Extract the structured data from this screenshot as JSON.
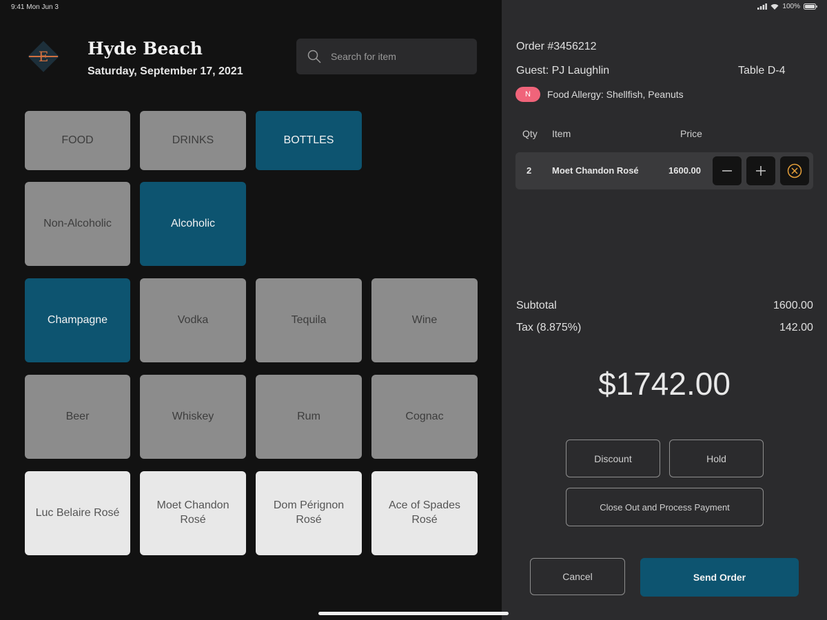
{
  "status_bar": {
    "time_date": "9:41 Mon Jun 3",
    "battery": "100%"
  },
  "header": {
    "venue": "Hyde Beach",
    "date": "Saturday, September 17, 2021",
    "logo_letter": "E"
  },
  "search": {
    "placeholder": "Search for item"
  },
  "categories": [
    "FOOD",
    "DRINKS",
    "BOTTLES"
  ],
  "subcategories": [
    "Non-Alcoholic",
    "Alcoholic"
  ],
  "drink_types": [
    "Champagne",
    "Vodka",
    "Tequila",
    "Wine",
    "Beer",
    "Whiskey",
    "Rum",
    "Cognac"
  ],
  "products": [
    "Luc Belaire Rosé",
    "Moet Chandon Rosé",
    "Dom Pérignon Rosé",
    "Ace of Spades Rosé"
  ],
  "order": {
    "number": "Order #3456212",
    "guest": "Guest: PJ Laughlin",
    "table": "Table D-4",
    "allergy_badge": "N",
    "allergy": "Food Allergy: Shellfish, Peanuts",
    "columns": {
      "qty": "Qty",
      "item": "Item",
      "price": "Price"
    },
    "items": [
      {
        "qty": "2",
        "name": "Moet Chandon Rosé",
        "price": "1600.00"
      }
    ],
    "subtotal_label": "Subtotal",
    "subtotal": "1600.00",
    "tax_label": "Tax (8.875%)",
    "tax": "142.00",
    "total": "$1742.00"
  },
  "actions": {
    "discount": "Discount",
    "hold": "Hold",
    "close_out": "Close Out and Process Payment",
    "cancel": "Cancel",
    "send": "Send Order"
  },
  "colors": {
    "accent": "#0d5470",
    "allergy": "#f0647a",
    "panel": "#2b2b2d",
    "background": "#121212"
  }
}
